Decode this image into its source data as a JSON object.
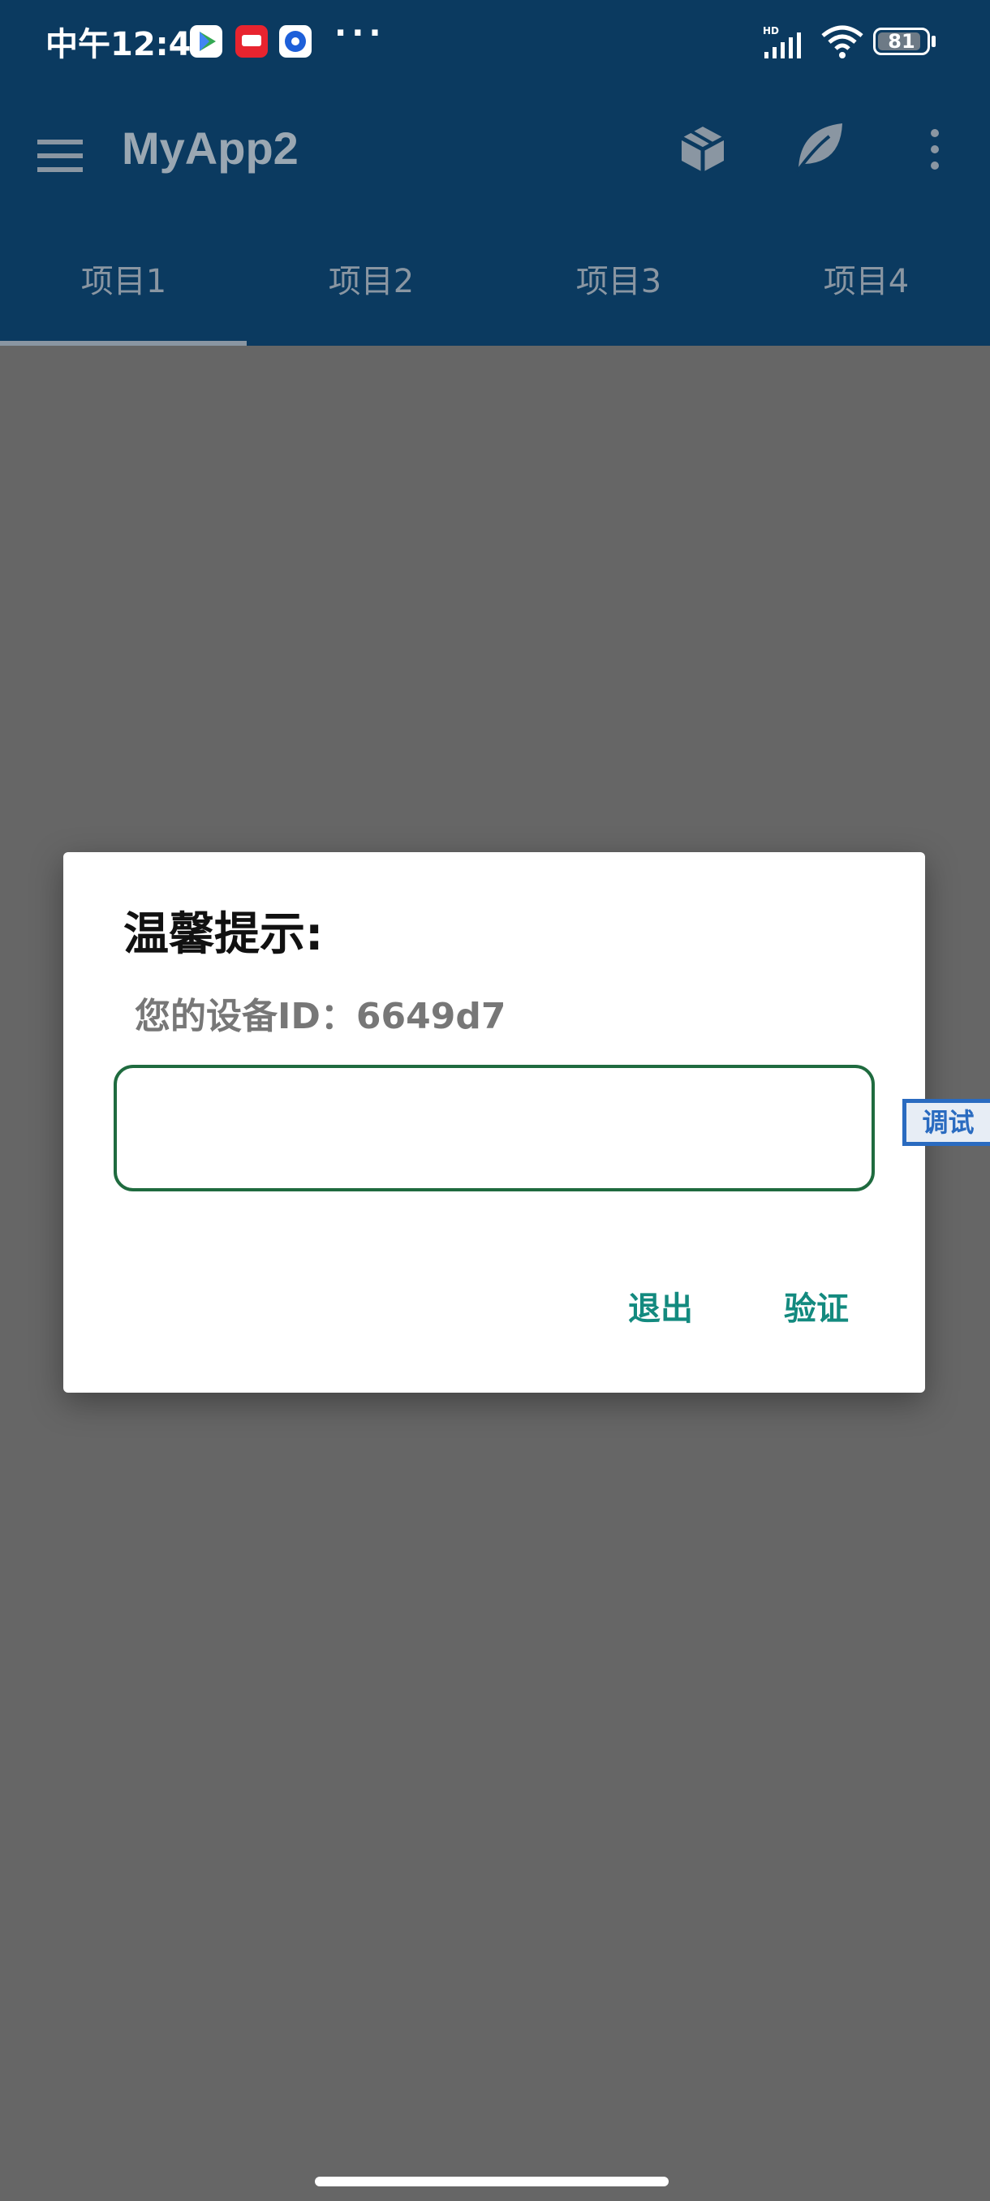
{
  "status_bar": {
    "time": "中午12:41",
    "more": "···",
    "battery": "81",
    "network_label": "HD"
  },
  "app_bar": {
    "title": "MyApp2",
    "icons": [
      "menu-icon",
      "cube-icon",
      "leaf-icon",
      "more-vert-icon"
    ]
  },
  "tabs": [
    {
      "label": "项目1",
      "selected": true
    },
    {
      "label": "项目2",
      "selected": false
    },
    {
      "label": "项目3",
      "selected": false
    },
    {
      "label": "项目4",
      "selected": false
    }
  ],
  "dialog": {
    "title": "温馨提示:",
    "message": "您的设备ID：6649d7",
    "input_value": "",
    "exit_label": "退出",
    "verify_label": "验证"
  },
  "debug_tag": "调试",
  "colors": {
    "app_bar": "#0b3a60",
    "scrim": "#666666",
    "dialog_button": "#138a7f",
    "input_border": "#1f6b3f",
    "debug_tag": "#2a6bc0"
  }
}
